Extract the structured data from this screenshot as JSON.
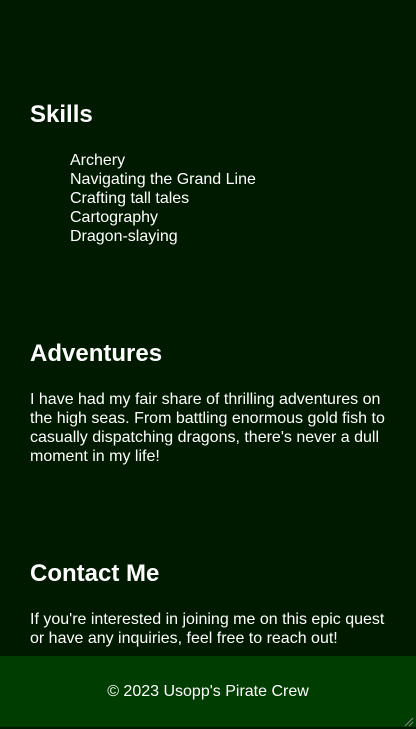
{
  "skills": {
    "heading": "Skills",
    "items": [
      "Archery",
      "Navigating the Grand Line",
      "Crafting tall tales",
      "Cartography",
      "Dragon-slaying"
    ]
  },
  "adventures": {
    "heading": "Adventures",
    "text": "I have had my fair share of thrilling adventures on the high seas. From battling enormous gold fish to casually dispatching dragons, there's never a dull moment in my life!"
  },
  "contact": {
    "heading": "Contact Me",
    "text": "If you're interested in joining me on this epic quest or have any inquiries, feel free to reach out!"
  },
  "footer": {
    "text": "© 2023 Usopp's Pirate Crew"
  },
  "colors": {
    "background": "#001a00",
    "footer_background": "#003d00",
    "text": "#ffffff"
  },
  "icons": {
    "resize": "resize-grip-icon"
  }
}
